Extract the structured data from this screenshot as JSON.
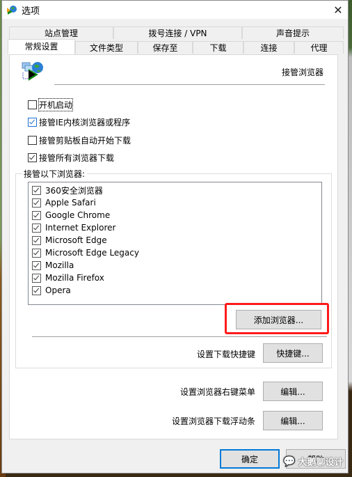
{
  "window": {
    "title": "选项",
    "close_label": "✕"
  },
  "tabs": {
    "row_back": [
      {
        "label": "站点管理"
      },
      {
        "label": "拨号连接 / VPN"
      },
      {
        "label": "声音提示"
      }
    ],
    "row_front": [
      {
        "label": "常规设置",
        "active": true
      },
      {
        "label": "文件类型"
      },
      {
        "label": "保存至"
      },
      {
        "label": "下载"
      },
      {
        "label": "连接"
      },
      {
        "label": "代理"
      }
    ]
  },
  "panel": {
    "header_title": "接管浏览器",
    "options": [
      {
        "label": "开机启动",
        "checked": false
      },
      {
        "label": "接管IE内核浏览器或程序",
        "checked": true
      },
      {
        "label": "接管剪贴板自动开始下载",
        "checked": false
      },
      {
        "label": "接管所有浏览器下载",
        "checked": true
      }
    ],
    "group_label": "接管以下浏览器:",
    "browsers": [
      {
        "label": "360安全浏览器",
        "checked": true
      },
      {
        "label": "Apple Safari",
        "checked": true
      },
      {
        "label": "Google Chrome",
        "checked": true
      },
      {
        "label": "Internet Explorer",
        "checked": true
      },
      {
        "label": "Microsoft Edge",
        "checked": true
      },
      {
        "label": "Microsoft Edge Legacy",
        "checked": true
      },
      {
        "label": "Mozilla",
        "checked": true
      },
      {
        "label": "Mozilla Firefox",
        "checked": true
      },
      {
        "label": "Opera",
        "checked": true
      }
    ],
    "add_browser_button": "添加浏览器...",
    "hotkey_label": "设置下载快捷键",
    "hotkey_button": "快捷键...",
    "context_menu_label": "设置浏览器右键菜单",
    "context_menu_button": "编辑...",
    "float_bar_label": "设置浏览器下载浮动条",
    "float_bar_button": "编辑..."
  },
  "footer": {
    "ok_button": "确定",
    "help_button": "帮助"
  },
  "watermark": {
    "text": "大鹅聊设计",
    "icon": "wechat-icon"
  },
  "colors": {
    "highlight_border": "#ff1a1a",
    "default_button_border": "#0078d7",
    "checkbox_focus": "#1f6fd0"
  }
}
